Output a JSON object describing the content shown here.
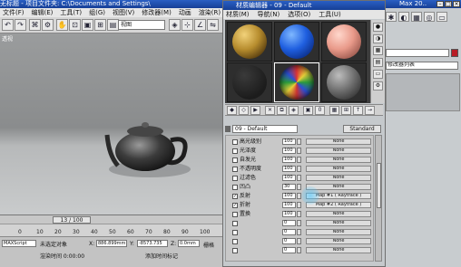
{
  "window": {
    "title": "无标题  - 项目文件夹: C:\\Documents and Settings\\"
  },
  "menu": [
    "文件(F)",
    "编辑(E)",
    "工具(T)",
    "组(G)",
    "视图(V)",
    "修改器(M)",
    "动画",
    "渲染(R)",
    "帮"
  ],
  "toolbar": {
    "buttons": [
      "↶",
      "↷",
      "⌘",
      "⚙",
      "✋",
      "⊡",
      "▣",
      "⊞",
      "▤"
    ],
    "view_select": "视图"
  },
  "viewport": {
    "label": "透视"
  },
  "timeline": {
    "frame_text": "13 / 100",
    "ruler": [
      "0",
      "10",
      "20",
      "30",
      "40",
      "50",
      "60",
      "70",
      "80",
      "90",
      "100"
    ]
  },
  "status": {
    "left1": "未选定对象",
    "left2": "渲染时间 0:00:00",
    "script": "MAXScript",
    "x_label": "X:",
    "x_val": "886.899mm",
    "y_label": "Y:",
    "y_val": "-8573.735",
    "z_label": "Z:",
    "z_val": "0.0mm",
    "grid": "栅格",
    "add_key": "添加时间标记"
  },
  "material_editor": {
    "title": "材质编辑器 - 09 - Default",
    "menu": [
      "材质(M)",
      "导航(N)",
      "选项(O)",
      "工具(U)"
    ],
    "material_name": "09 - Default",
    "type_button": "Standard",
    "maps": [
      {
        "label": "高光级别",
        "amount": "100",
        "map": "None",
        "checked": false
      },
      {
        "label": "光泽度",
        "amount": "100",
        "map": "None",
        "checked": false
      },
      {
        "label": "自发光",
        "amount": "100",
        "map": "None",
        "checked": false
      },
      {
        "label": "不透明度",
        "amount": "100",
        "map": "None",
        "checked": false
      },
      {
        "label": "过滤色",
        "amount": "100",
        "map": "None",
        "checked": false
      },
      {
        "label": "凹凸",
        "amount": "30",
        "map": "None",
        "checked": false
      },
      {
        "label": "反射",
        "amount": "100",
        "map": "Map #1 ( Raytrace )",
        "checked": true
      },
      {
        "label": "折射",
        "amount": "100",
        "map": "Map #2 ( Raytrace )",
        "checked": true
      },
      {
        "label": "置换",
        "amount": "100",
        "map": "None",
        "checked": false
      },
      {
        "label": "",
        "amount": "0",
        "map": "None",
        "checked": false
      },
      {
        "label": "",
        "amount": "0",
        "map": "None",
        "checked": false
      },
      {
        "label": "",
        "amount": "0",
        "map": "None",
        "checked": false
      },
      {
        "label": "",
        "amount": "0",
        "map": "None",
        "checked": false
      }
    ]
  },
  "right_panel": {
    "title": "Max 20..",
    "modifier_list": "修改器列表"
  },
  "colors": {
    "title_blue": "#1f4fb0",
    "slot_bg": "#2e2e2e"
  }
}
